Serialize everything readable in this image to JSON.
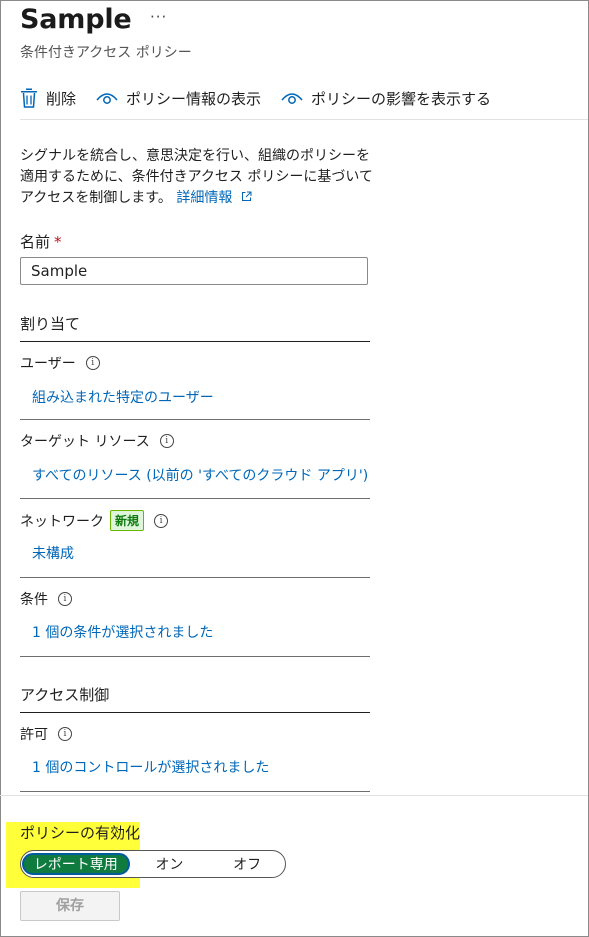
{
  "header": {
    "title": "Sample",
    "more_label": "···",
    "subtitle": "条件付きアクセス ポリシー"
  },
  "toolbar": {
    "delete_label": "削除",
    "policy_info_label": "ポリシー情報の表示",
    "policy_impact_label": "ポリシーの影響を表示する"
  },
  "description": {
    "text": "シグナルを統合し、意思決定を行い、組織のポリシーを適用するために、条件付きアクセス ポリシーに基づいてアクセスを制御します。",
    "link_label": "詳細情報"
  },
  "name_field": {
    "label": "名前",
    "required_mark": "*",
    "value": "Sample"
  },
  "assignments": {
    "heading": "割り当て",
    "users": {
      "label": "ユーザー",
      "value": "組み込まれた特定のユーザー"
    },
    "target_resources": {
      "label": "ターゲット リソース",
      "value": "すべてのリソース (以前の 'すべてのクラウド アプリ')"
    },
    "network": {
      "label": "ネットワーク",
      "badge": "新規",
      "value": "未構成"
    },
    "conditions": {
      "label": "条件",
      "value": "1 個の条件が選択されました"
    }
  },
  "access_controls": {
    "heading": "アクセス制御",
    "grant": {
      "label": "許可",
      "value": "1 個のコントロールが選択されました"
    }
  },
  "enable_policy": {
    "label": "ポリシーの有効化",
    "options": [
      "レポート専用",
      "オン",
      "オフ"
    ],
    "selected": "レポート専用",
    "highlight_color": "#ffff3a"
  },
  "save_label": "保存",
  "colors": {
    "link": "#0067b8",
    "selected_toggle": "#0f7b3e",
    "badge_green": "#107c10"
  }
}
